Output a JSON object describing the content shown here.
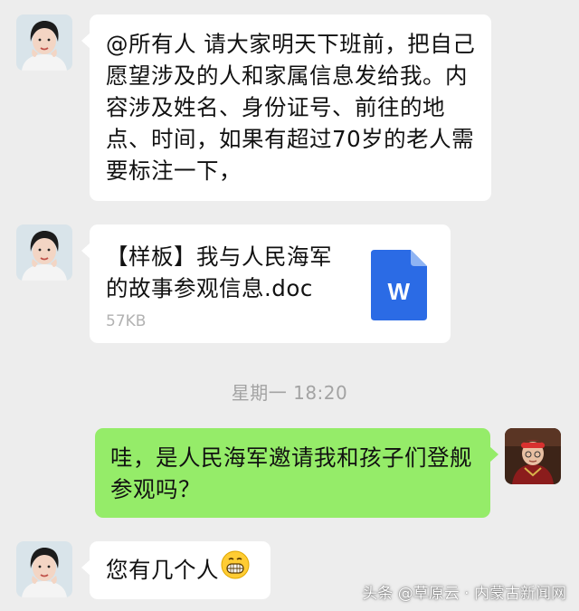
{
  "messages": [
    {
      "text": "@所有人 请大家明天下班前，把自己愿望涉及的人和家属信息发给我。内容涉及姓名、身份证号、前往的地点、时间，如果有超过70岁的老人需要标注一下，"
    },
    {
      "file": {
        "name": "【样板】我与人民海军的故事参观信息.doc",
        "size": "57KB",
        "icon": "word-doc-icon",
        "icon_color": "#2b6be5"
      }
    },
    {
      "text": "哇，是人民海军邀请我和孩子们登舰参观吗？"
    },
    {
      "text": "您有几个人",
      "emoji": "grinning-face-emoji"
    }
  ],
  "timestamp": "星期一 18:20",
  "watermark": "头条 @草原云 · 内蒙古新闻网",
  "colors": {
    "background": "#ededed",
    "incoming_bubble": "#ffffff",
    "outgoing_bubble": "#95ec69",
    "timestamp": "#a3a3a3"
  }
}
